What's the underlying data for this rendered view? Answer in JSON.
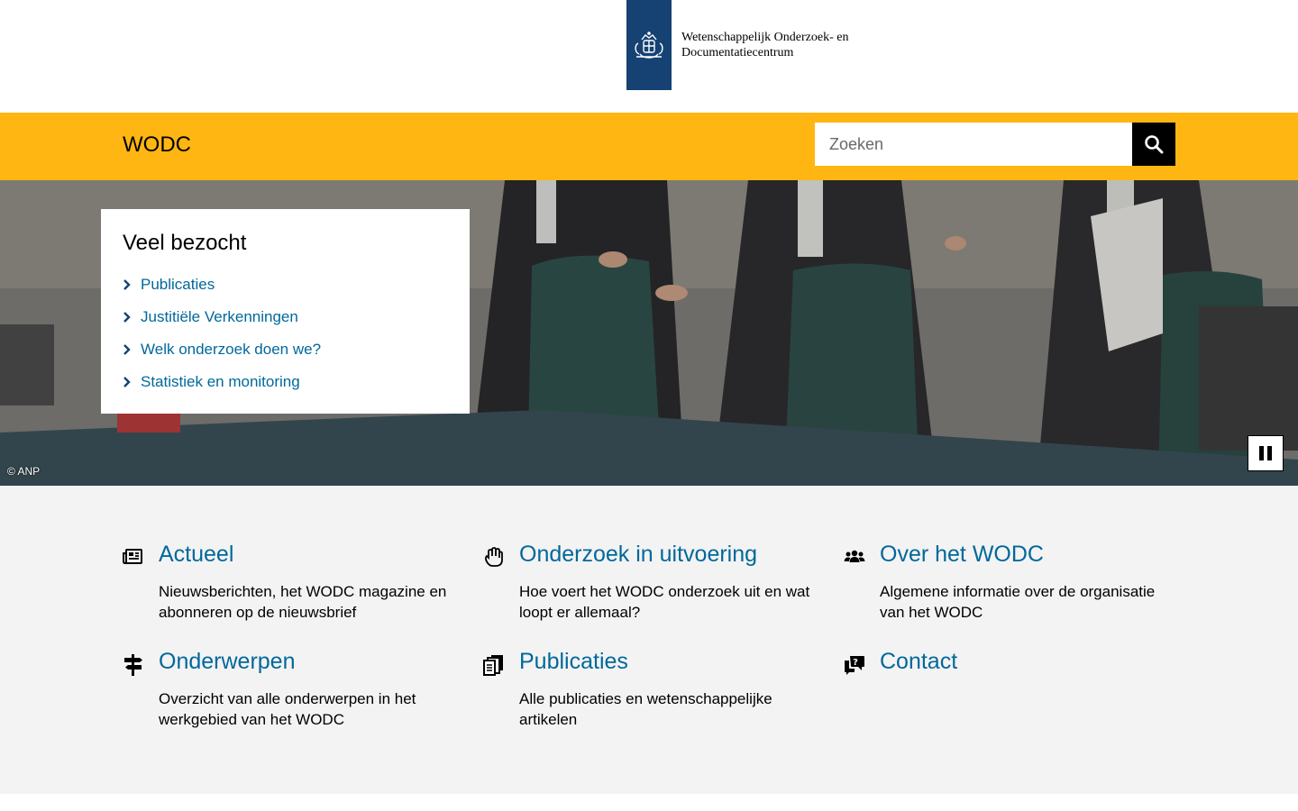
{
  "header": {
    "logo_line1": "Wetenschappelijk Onderzoek- en",
    "logo_line2": "Documentatiecentrum"
  },
  "brand_bar": {
    "site_name": "WODC",
    "search_placeholder": "Zoeken",
    "color": "#ffb612"
  },
  "hero": {
    "credit": "© ANP",
    "popular": {
      "title": "Veel bezocht",
      "items": [
        {
          "label": "Publicaties"
        },
        {
          "label": "Justitiële Verkenningen"
        },
        {
          "label": "Welk onderzoek doen we?"
        },
        {
          "label": "Statistiek en monitoring"
        }
      ]
    }
  },
  "tiles": [
    {
      "icon": "newspaper-icon",
      "title": "Actueel",
      "text": "Nieuwsberichten, het WODC magazine en abonneren op de nieuwsbrief"
    },
    {
      "icon": "hand-icon",
      "title": "Onderzoek in uitvoering",
      "text": "Hoe voert het WODC onderzoek uit en wat loopt er allemaal?"
    },
    {
      "icon": "people-icon",
      "title": "Over het WODC",
      "text": "Algemene informatie over de organisatie van het WODC"
    },
    {
      "icon": "signpost-icon",
      "title": "Onderwerpen",
      "text": "Overzicht van alle onderwerpen in het werkgebied van het WODC"
    },
    {
      "icon": "documents-icon",
      "title": "Publicaties",
      "text": "Alle publicaties en wetenschappelijke artikelen"
    },
    {
      "icon": "chat-question-icon",
      "title": "Contact",
      "text": ""
    }
  ],
  "colors": {
    "link": "#01689b",
    "logo_blue": "#154273",
    "tiles_bg": "#f3f3f3"
  }
}
